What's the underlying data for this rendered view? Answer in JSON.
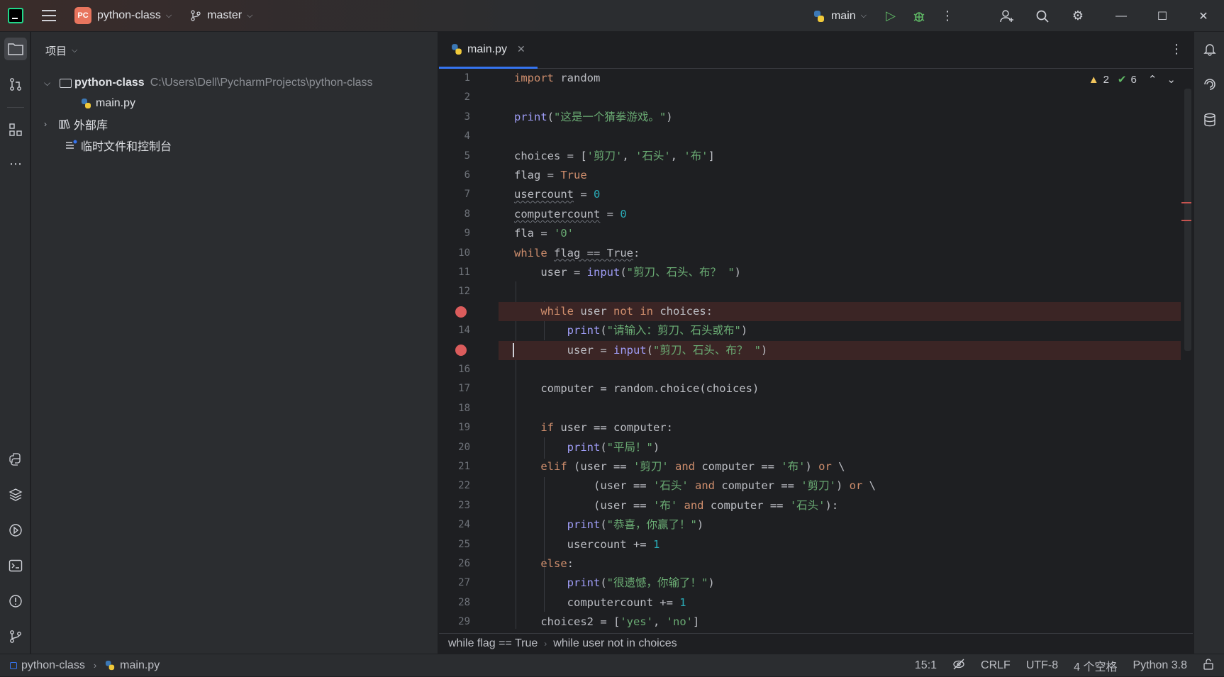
{
  "titlebar": {
    "project_badge": "PC",
    "project_name": "python-class",
    "branch": "master",
    "run_config": "main"
  },
  "project_panel": {
    "title": "项目",
    "root_name": "python-class",
    "root_path": "C:\\Users\\Dell\\PycharmProjects\\python-class",
    "file": "main.py",
    "external_libs": "外部库",
    "scratches": "临时文件和控制台"
  },
  "editor": {
    "tab_label": "main.py",
    "warnings": "2",
    "ok_count": "6",
    "line_numbers": [
      "1",
      "2",
      "3",
      "4",
      "5",
      "6",
      "7",
      "8",
      "9",
      "10",
      "11",
      "12",
      "13",
      "14",
      "15",
      "16",
      "17",
      "18",
      "19",
      "20",
      "21",
      "22",
      "23",
      "24",
      "25",
      "26",
      "27",
      "28",
      "29"
    ],
    "code": {
      "l1_kw": "import",
      "l1_rest": " random",
      "l3_fn": "print",
      "l3_str": "\"这是一个猜拳游戏。\"",
      "l5_a": "choices = [",
      "l5_s1": "'剪刀'",
      "l5_s2": "'石头'",
      "l5_s3": "'布'",
      "l6_a": "flag = ",
      "l6_kw": "True",
      "l7_var": "usercount",
      "l7_num": "0",
      "l8_var": "computercount",
      "l8_num": "0",
      "l9_a": "fla = ",
      "l9_str": "'0'",
      "l10_kw": "while",
      "l10_cond": "flag == True",
      "l10_end": ":",
      "l11_a": "    user = ",
      "l11_fn": "input",
      "l11_str": "\"剪刀、石头、布？ \"",
      "l13_kw": "while",
      "l13_a": " user ",
      "l13_kw2": "not in",
      "l13_b": " choices:",
      "l14_fn": "print",
      "l14_str": "\"请输入：剪刀、石头或布\"",
      "l15_a": "user = ",
      "l15_fn": "input",
      "l15_str": "\"剪刀、石头、布？ \"",
      "l17": "    computer = random.choice(choices)",
      "l19_kw": "if",
      "l19_a": " user == computer:",
      "l20_fn": "print",
      "l20_str": "\"平局！\"",
      "l21_kw": "elif",
      "l21_a": " (user == ",
      "l21_s1": "'剪刀'",
      "l21_kw2": "and",
      "l21_b": " computer == ",
      "l21_s2": "'布'",
      "l21_c": ") ",
      "l21_kw3": "or",
      "l21_d": " \\",
      "l22_a": "(user == ",
      "l22_s1": "'石头'",
      "l22_kw2": "and",
      "l22_b": " computer == ",
      "l22_s2": "'剪刀'",
      "l22_c": ") ",
      "l22_kw3": "or",
      "l22_d": " \\",
      "l23_a": "(user == ",
      "l23_s1": "'布'",
      "l23_kw2": "and",
      "l23_b": " computer == ",
      "l23_s2": "'石头'",
      "l23_c": "):",
      "l24_fn": "print",
      "l24_str": "\"恭喜，你赢了！\"",
      "l25_a": "usercount += ",
      "l25_num": "1",
      "l26_kw": "else",
      "l27_fn": "print",
      "l27_str": "\"很遗憾，你输了！\"",
      "l28_a": "computercount += ",
      "l28_num": "1",
      "l29_a": "    choices2 = [",
      "l29_s1": "'yes'",
      "l29_s2": "'no'"
    }
  },
  "breadcrumbs": [
    "while flag == True",
    "while user not in choices"
  ],
  "statusbar": {
    "project": "python-class",
    "file": "main.py",
    "position": "15:1",
    "line_sep": "CRLF",
    "encoding": "UTF-8",
    "indent": "4 个空格",
    "interpreter": "Python 3.8"
  },
  "colors": {
    "accent": "#3574f0",
    "breakpoint": "#db5c5c",
    "keyword": "#cf8e6d",
    "string": "#6aab73",
    "number": "#2aacb8",
    "function": "#9f9df7"
  }
}
